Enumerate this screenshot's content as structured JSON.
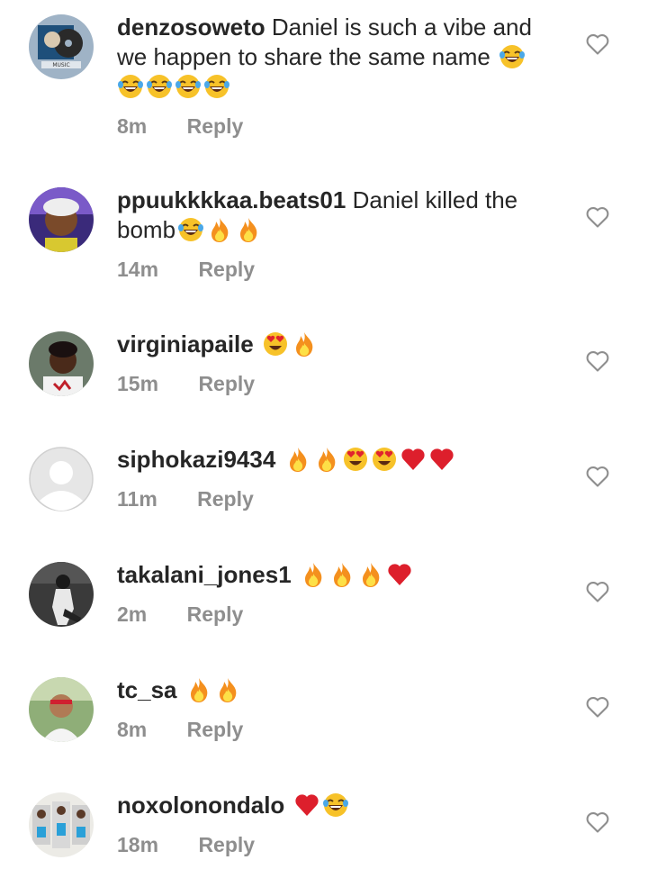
{
  "comments": [
    {
      "username": "denzosoweto",
      "text": "Daniel is such a vibe and we happen to share the same name",
      "emojis": [
        "laugh",
        "laugh",
        "laugh",
        "laugh",
        "laugh"
      ],
      "time": "8m",
      "reply": "Reply",
      "avatar": "album-cover-avatar",
      "avatar_text": "MUSIC"
    },
    {
      "username": "ppuukkkkaa.beats01",
      "text": "Daniel killed the bomb",
      "emojis": [
        "laugh",
        "fire",
        "fire"
      ],
      "time": "14m",
      "reply": "Reply",
      "avatar": "person-avatar"
    },
    {
      "username": "virginiapaile",
      "text": "",
      "emojis": [
        "heart-eyes",
        "fire"
      ],
      "time": "15m",
      "reply": "Reply",
      "avatar": "person-avatar"
    },
    {
      "username": "siphokazi9434",
      "text": "",
      "emojis": [
        "fire",
        "fire",
        "heart-eyes",
        "heart-eyes",
        "red-heart",
        "red-heart"
      ],
      "time": "11m",
      "reply": "Reply",
      "avatar": "default-avatar"
    },
    {
      "username": "takalani_jones1",
      "text": "",
      "emojis": [
        "fire",
        "fire",
        "fire",
        "red-heart"
      ],
      "time": "2m",
      "reply": "Reply",
      "avatar": "person-avatar"
    },
    {
      "username": "tc_sa",
      "text": "",
      "emojis": [
        "fire",
        "fire"
      ],
      "time": "8m",
      "reply": "Reply",
      "avatar": "person-avatar"
    },
    {
      "username": "noxolonondalo",
      "text": "",
      "emojis": [
        "red-heart",
        "laugh"
      ],
      "time": "18m",
      "reply": "Reply",
      "avatar": "group-photo-avatar"
    }
  ],
  "colors": {
    "text": "#262626",
    "meta": "#8e8e8e",
    "heart_outline": "#8e8e8e"
  }
}
